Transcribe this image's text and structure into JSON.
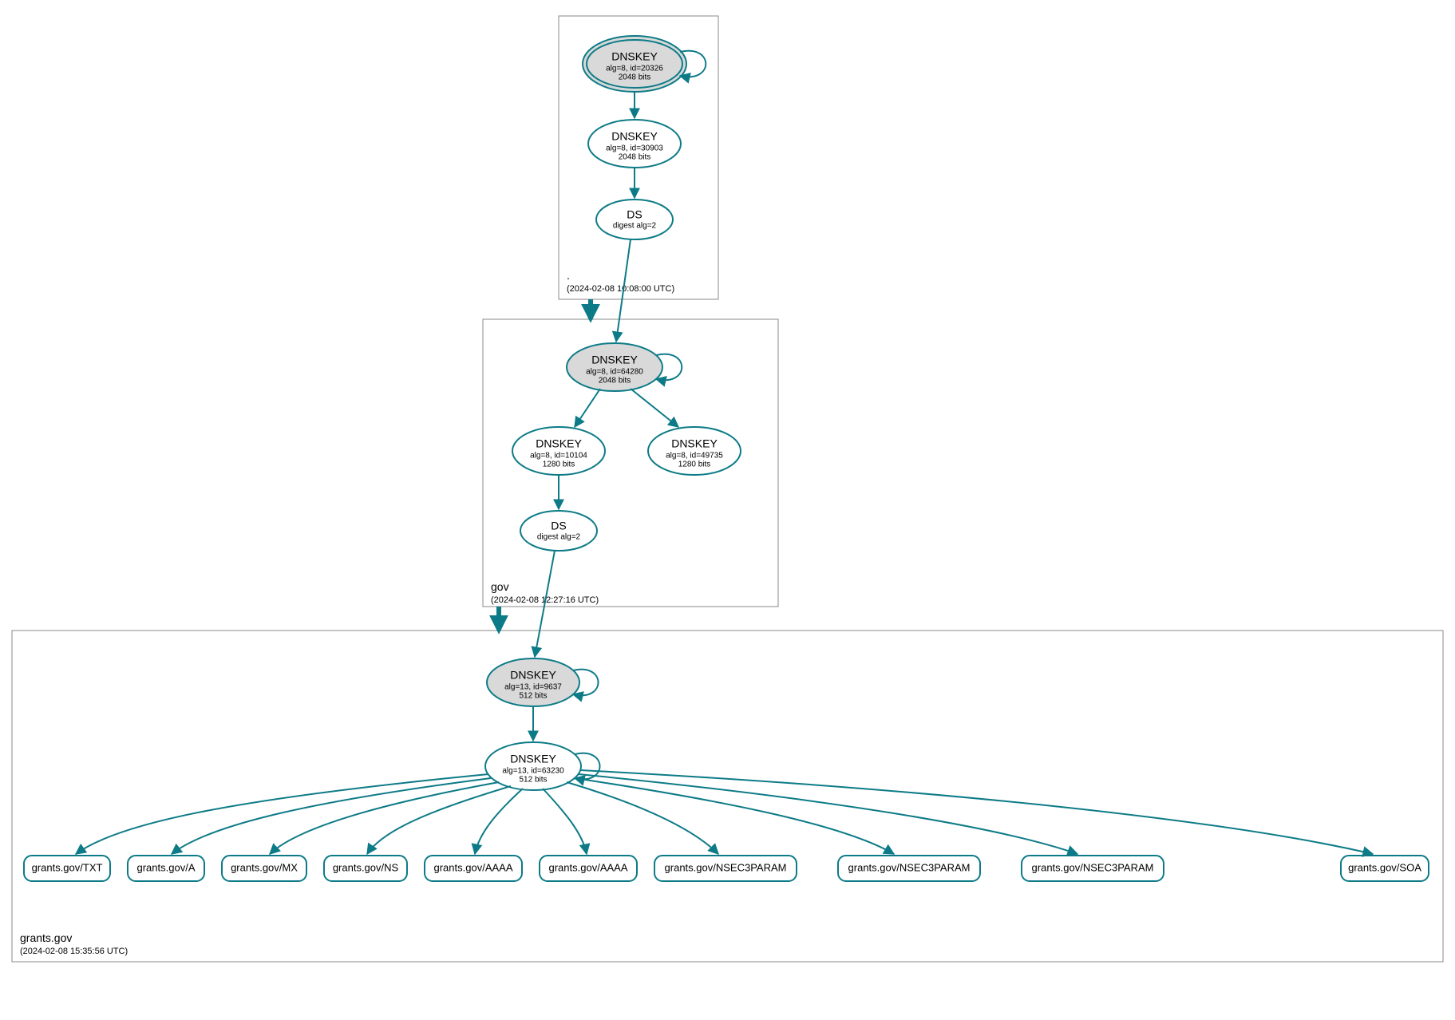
{
  "colors": {
    "edge": "#0d7b87",
    "ksk_fill": "#d9d9d9",
    "zone_stroke": "#888888"
  },
  "zones": {
    "root": {
      "name": ".",
      "timestamp": "(2024-02-08 10:08:00 UTC)"
    },
    "gov": {
      "name": "gov",
      "timestamp": "(2024-02-08 12:27:16 UTC)"
    },
    "grants": {
      "name": "grants.gov",
      "timestamp": "(2024-02-08 15:35:56 UTC)"
    }
  },
  "nodes": {
    "root_ksk": {
      "title": "DNSKEY",
      "line2": "alg=8, id=20326",
      "line3": "2048 bits"
    },
    "root_zsk": {
      "title": "DNSKEY",
      "line2": "alg=8, id=30903",
      "line3": "2048 bits"
    },
    "root_ds": {
      "title": "DS",
      "line2": "digest alg=2"
    },
    "gov_ksk": {
      "title": "DNSKEY",
      "line2": "alg=8, id=64280",
      "line3": "2048 bits"
    },
    "gov_zsk1": {
      "title": "DNSKEY",
      "line2": "alg=8, id=10104",
      "line3": "1280 bits"
    },
    "gov_zsk2": {
      "title": "DNSKEY",
      "line2": "alg=8, id=49735",
      "line3": "1280 bits"
    },
    "gov_ds": {
      "title": "DS",
      "line2": "digest alg=2"
    },
    "grants_ksk": {
      "title": "DNSKEY",
      "line2": "alg=13, id=9637",
      "line3": "512 bits"
    },
    "grants_zsk": {
      "title": "DNSKEY",
      "line2": "alg=13, id=63230",
      "line3": "512 bits"
    }
  },
  "rrsets": {
    "r0": "grants.gov/TXT",
    "r1": "grants.gov/A",
    "r2": "grants.gov/MX",
    "r3": "grants.gov/NS",
    "r4": "grants.gov/AAAA",
    "r5": "grants.gov/AAAA",
    "r6": "grants.gov/NSEC3PARAM",
    "r7": "grants.gov/NSEC3PARAM",
    "r8": "grants.gov/NSEC3PARAM",
    "r9": "grants.gov/SOA"
  }
}
